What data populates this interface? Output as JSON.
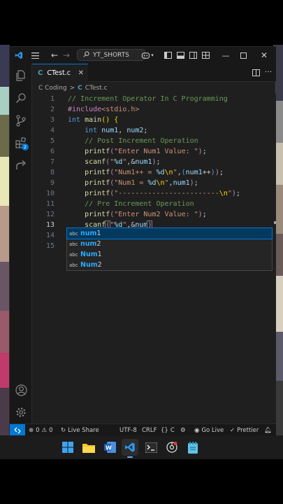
{
  "titlebar": {
    "search_label": "YT_SHORTS"
  },
  "tab": {
    "filename": "CTest.c",
    "lang_glyph": "C"
  },
  "breadcrumb": {
    "folder": "C Coding",
    "separator": ">",
    "file": "CTest.c"
  },
  "activity": {
    "extensions_badge": "2"
  },
  "editor": {
    "line_numbers": [
      "1",
      "2",
      "3",
      "4",
      "5",
      "6",
      "7",
      "8",
      "9",
      "10",
      "11",
      "12",
      "13",
      "14",
      "15"
    ],
    "current_line": "13"
  },
  "suggestions": [
    {
      "kind": "abc",
      "match": "num",
      "rest": "1"
    },
    {
      "kind": "abc",
      "match": "num",
      "rest": "2"
    },
    {
      "kind": "abc",
      "match": "Num",
      "rest": "1"
    },
    {
      "kind": "abc",
      "match": "Num",
      "rest": "2"
    }
  ],
  "statusbar": {
    "errors": "0",
    "warnings": "0",
    "live_share": "Live Share",
    "encoding": "UTF-8",
    "eol": "CRLF",
    "language": "C",
    "go_live": "Go Live",
    "prettier": "Prettier"
  },
  "colors": {
    "accent": "#0078d4",
    "editor_bg": "#1f1f1f",
    "comment": "#6a9955",
    "keyword": "#569cd6",
    "string": "#ce9178",
    "function": "#dcdcaa"
  }
}
